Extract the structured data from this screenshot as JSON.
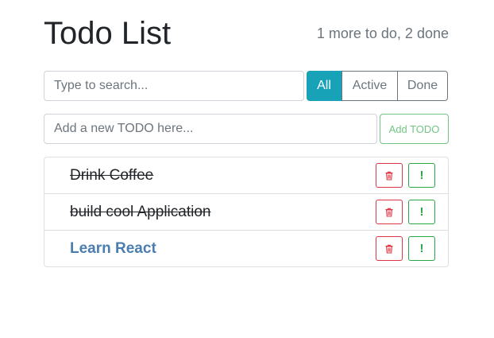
{
  "header": {
    "title": "Todo List",
    "counter": "1 more to do, 2 done"
  },
  "search": {
    "placeholder": "Type to search...",
    "value": ""
  },
  "filters": {
    "all_label": "All",
    "active_label": "Active",
    "done_label": "Done",
    "selected": "All"
  },
  "add_form": {
    "placeholder": "Add a new TODO here...",
    "value": "",
    "button_label": "Add TODO"
  },
  "todos": [
    {
      "label": "Drink Coffee",
      "done": true,
      "important": false
    },
    {
      "label": "build cool Application",
      "done": true,
      "important": false
    },
    {
      "label": "Learn React",
      "done": false,
      "important": true
    }
  ],
  "item_buttons": {
    "delete_icon": "trash-icon",
    "important_icon": "exclamation-icon",
    "important_glyph": "!"
  },
  "colors": {
    "accent_info": "#17a2b8",
    "success": "#28a745",
    "danger": "#dc3545",
    "important_text": "#4a7eb0",
    "muted": "#6c757d"
  }
}
